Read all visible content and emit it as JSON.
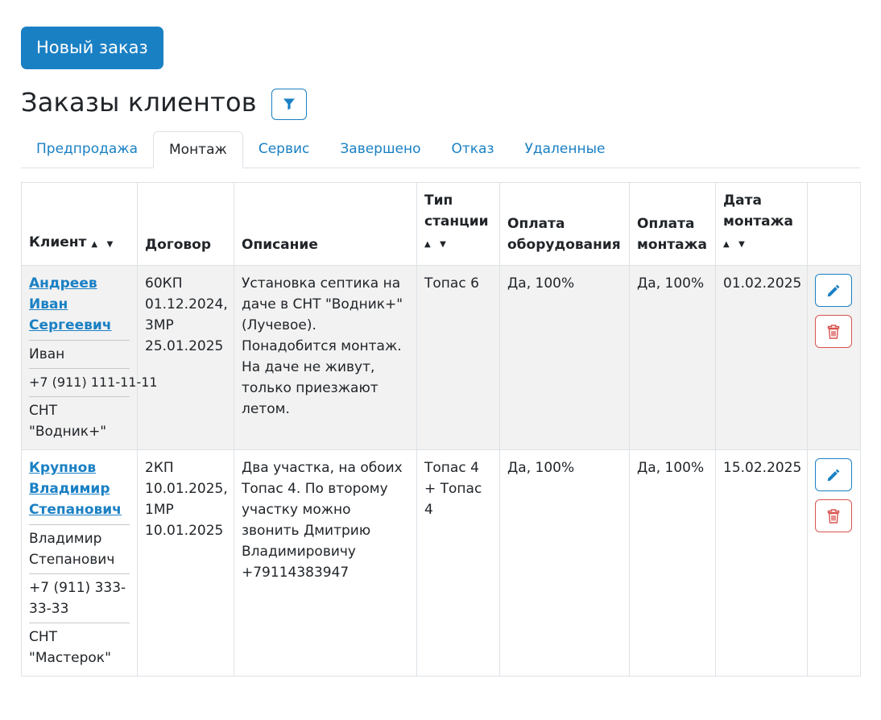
{
  "toolbar": {
    "new_order_label": "Новый заказ"
  },
  "header": {
    "title": "Заказы клиентов"
  },
  "colors": {
    "accent": "#1a80c4",
    "danger": "#d9534f",
    "row_shade": "#f2f2f2"
  },
  "tabs": [
    {
      "label": "Предпродажа",
      "active": false
    },
    {
      "label": "Монтаж",
      "active": true
    },
    {
      "label": "Сервис",
      "active": false
    },
    {
      "label": "Завершено",
      "active": false
    },
    {
      "label": "Отказ",
      "active": false
    },
    {
      "label": "Удаленные",
      "active": false
    }
  ],
  "table": {
    "columns": {
      "client": "Клиент",
      "contract": "Договор",
      "description": "Описание",
      "station_type": "Тип станции",
      "equipment_payment": "Оплата оборудования",
      "install_payment": "Оплата монтажа",
      "install_date": "Дата монтажа"
    },
    "sort_glyph": "▲ ▼",
    "rows": [
      {
        "client_name": "Андреев Иван Сергеевич",
        "contact": "Иван",
        "phone": "+7 (911) 111-11-11",
        "location": "СНТ \"Водник+\"",
        "contract": "60КП 01.12.2024, 3МР 25.01.2025",
        "description": "Установка септика на даче в СНТ \"Водник+\" (Лучевое). Понадобится монтаж. На даче не живут, только приезжают летом.",
        "station_type": "Топас 6",
        "equipment_payment": "Да, 100%",
        "install_payment": "Да, 100%",
        "install_date": "01.02.2025"
      },
      {
        "client_name": "Крупнов Владимир Степанович",
        "contact": "Владимир Степанович",
        "phone": "+7 (911) 333-33-33",
        "location": "СНТ \"Мастерок\"",
        "contract": "2КП 10.01.2025, 1МР 10.01.2025",
        "description": "Два участка, на обоих Топас 4. По второму участку можно звонить Дмитрию Владимировичу +79114383947",
        "station_type": "Топас 4 + Топас 4",
        "equipment_payment": "Да, 100%",
        "install_payment": "Да, 100%",
        "install_date": "15.02.2025"
      }
    ]
  },
  "icons": {
    "filter": "filter-icon",
    "edit": "pencil-icon",
    "delete": "trash-icon"
  }
}
